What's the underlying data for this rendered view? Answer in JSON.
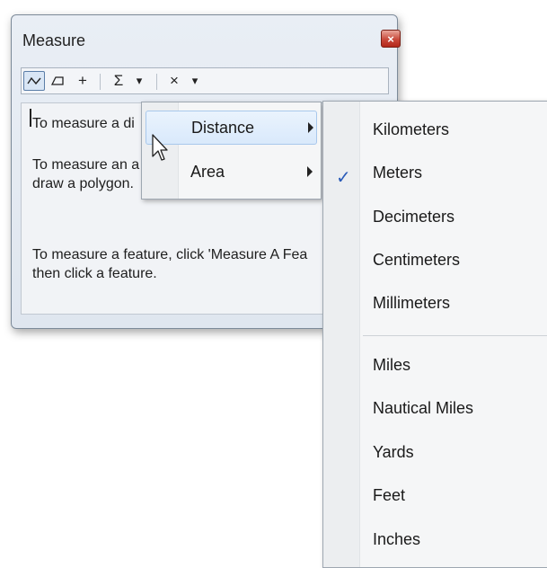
{
  "window": {
    "title": "Measure",
    "close_label": "×"
  },
  "toolbar": {
    "line_tool": "~",
    "area_tool": "◿",
    "feature_tool": "+",
    "sum_tool": "Σ",
    "sum_dropdown": "▾",
    "clear_tool": "×",
    "clear_dropdown": "▾"
  },
  "content": {
    "line1": "To measure a di",
    "line2a": "To measure an a",
    "line2b": "draw a polygon.",
    "line3a": "To measure a feature, click 'Measure A Fea",
    "line3b": "then click a feature."
  },
  "context_menu": {
    "items": [
      {
        "label": "Distance",
        "highlighted": true
      },
      {
        "label": "Area",
        "highlighted": false
      }
    ]
  },
  "units_menu": {
    "checked": "Meters",
    "items": [
      "Kilometers",
      "Meters",
      "Decimeters",
      "Centimeters",
      "Millimeters",
      "Miles",
      "Nautical Miles",
      "Yards",
      "Feet",
      "Inches"
    ]
  },
  "colors": {
    "accent": "#2a5bb8",
    "highlight": "#d9e9fb",
    "close": "#c8493a"
  }
}
